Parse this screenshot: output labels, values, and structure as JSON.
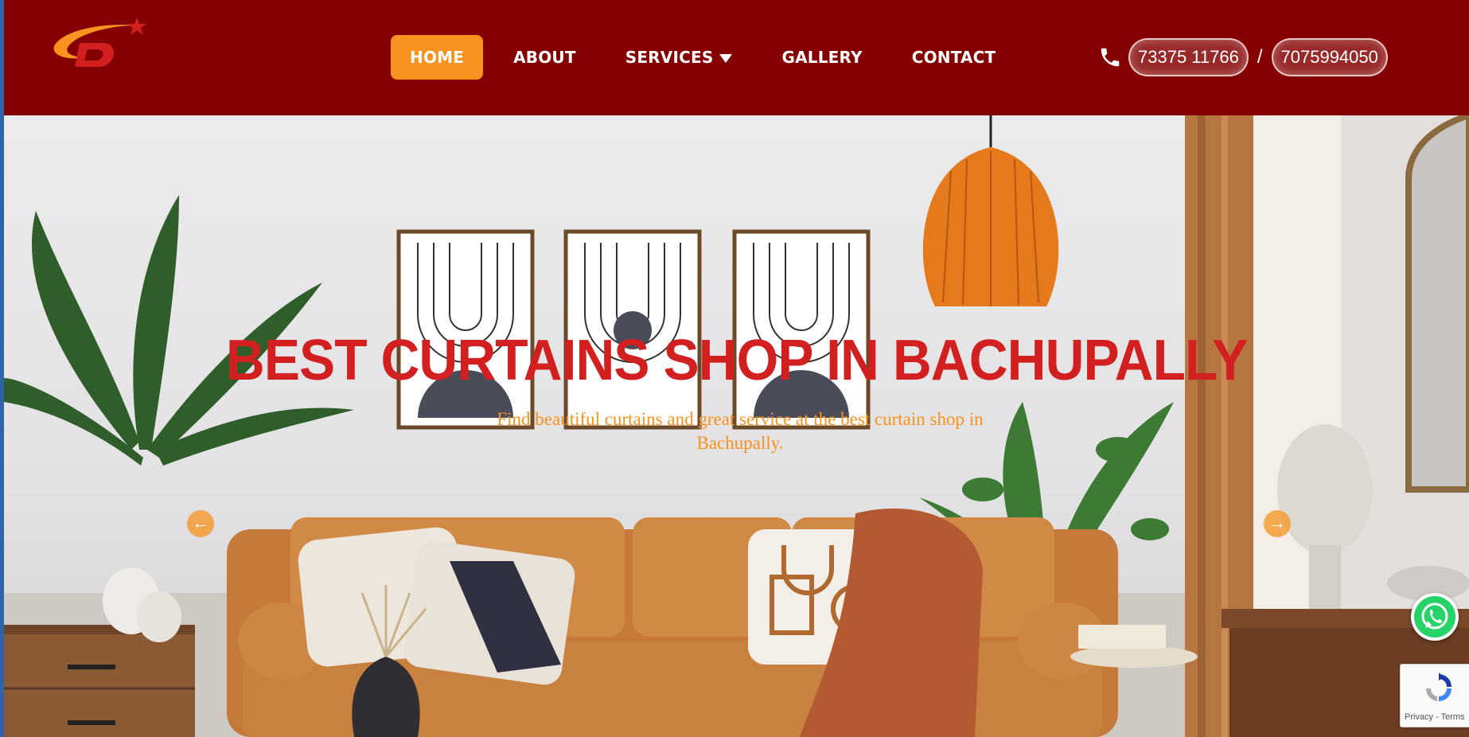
{
  "header": {
    "logo_icon": "brand-logo-swoosh-star",
    "nav": [
      {
        "label": "HOME",
        "active": true
      },
      {
        "label": "ABOUT"
      },
      {
        "label": "SERVICES",
        "has_dropdown": true
      },
      {
        "label": "GALLERY"
      },
      {
        "label": "CONTACT"
      }
    ],
    "phone_icon": "phone-icon",
    "phone_1": "73375 11766",
    "separator": "/",
    "phone_2": "7075994050"
  },
  "hero": {
    "title": "BEST CURTAINS SHOP IN BACHUPALLY",
    "subtitle": "Find beautiful curtains and great service at the best curtain shop in Bachupally.",
    "prev_icon": "arrow-left-icon",
    "next_icon": "arrow-right-icon"
  },
  "floating": {
    "whatsapp_icon": "whatsapp-icon",
    "recaptcha_links": "Privacy - Terms"
  },
  "colors": {
    "header_bg": "#850000",
    "accent": "#f7931e",
    "title_red": "#d1201f",
    "white": "#ffffff"
  }
}
